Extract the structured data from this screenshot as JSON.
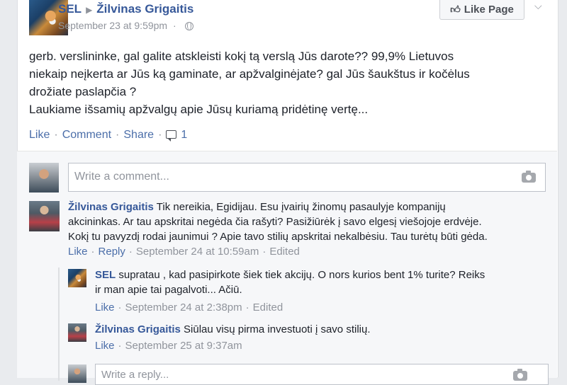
{
  "post": {
    "author": "SEL",
    "target": "Žilvinas Grigaitis",
    "timestamp": "September 23 at 9:59pm",
    "like_page_label": "Like Page",
    "text_lines": [
      "gerb. verslininke, gal galite atskleisti kokį tą verslą Jūs darote?? 99,9% Lietuvos",
      "niekaip neįkerta ar Jūs ką gaminate, ar apžvalginėjate? gal Jūs šaukštus ir kočėlus",
      "drožiate paslapčia ?",
      "Laukiame išsamių apžvalgų apie Jūsų kuriamą pridėtinę vertę..."
    ],
    "actions": {
      "like": "Like",
      "comment": "Comment",
      "share": "Share",
      "comment_count": "1"
    }
  },
  "composer": {
    "placeholder": "Write a comment..."
  },
  "comments": [
    {
      "author": "Žilvinas Grigaitis",
      "lines": [
        "Tik nereikia, Egidijau. Esu įvairių žinomų pasaulyje kompanijų",
        "akcininkas. Ar tau apskritai negėda čia rašyti? Pasižiūrėk į savo elgesį viešojoje erdvėje.",
        "Kokį tu pavyzdį rodai jaunimui ? Apie tavo stilių apskritai nekalbėsiu. Tau turėtų būti gėda."
      ],
      "like": "Like",
      "reply": "Reply",
      "time": "September 24 at 10:59am",
      "edited": "Edited"
    }
  ],
  "replies": [
    {
      "author": "SEL",
      "lines": [
        "supratau , kad pasipirkote šiek tiek akcijų. O nors kurios bent 1% turite? Reiks",
        "ir man apie tai pagalvoti... Ačiū."
      ],
      "like": "Like",
      "time": "September 24 at 2:38pm",
      "edited": "Edited"
    },
    {
      "author": "Žilvinas Grigaitis",
      "lines": [
        "Siūlau visų pirma investuoti į savo stilių."
      ],
      "like": "Like",
      "time": "September 25 at 9:37am"
    }
  ],
  "reply_composer": {
    "placeholder": "Write a reply..."
  },
  "icons": [
    "thumbs-up-icon",
    "chevron-down-icon",
    "globe-icon",
    "comment-bubble-icon",
    "camera-icon"
  ],
  "colors": {
    "link": "#365899",
    "meta": "#90949c",
    "background": "#e9ebee"
  }
}
